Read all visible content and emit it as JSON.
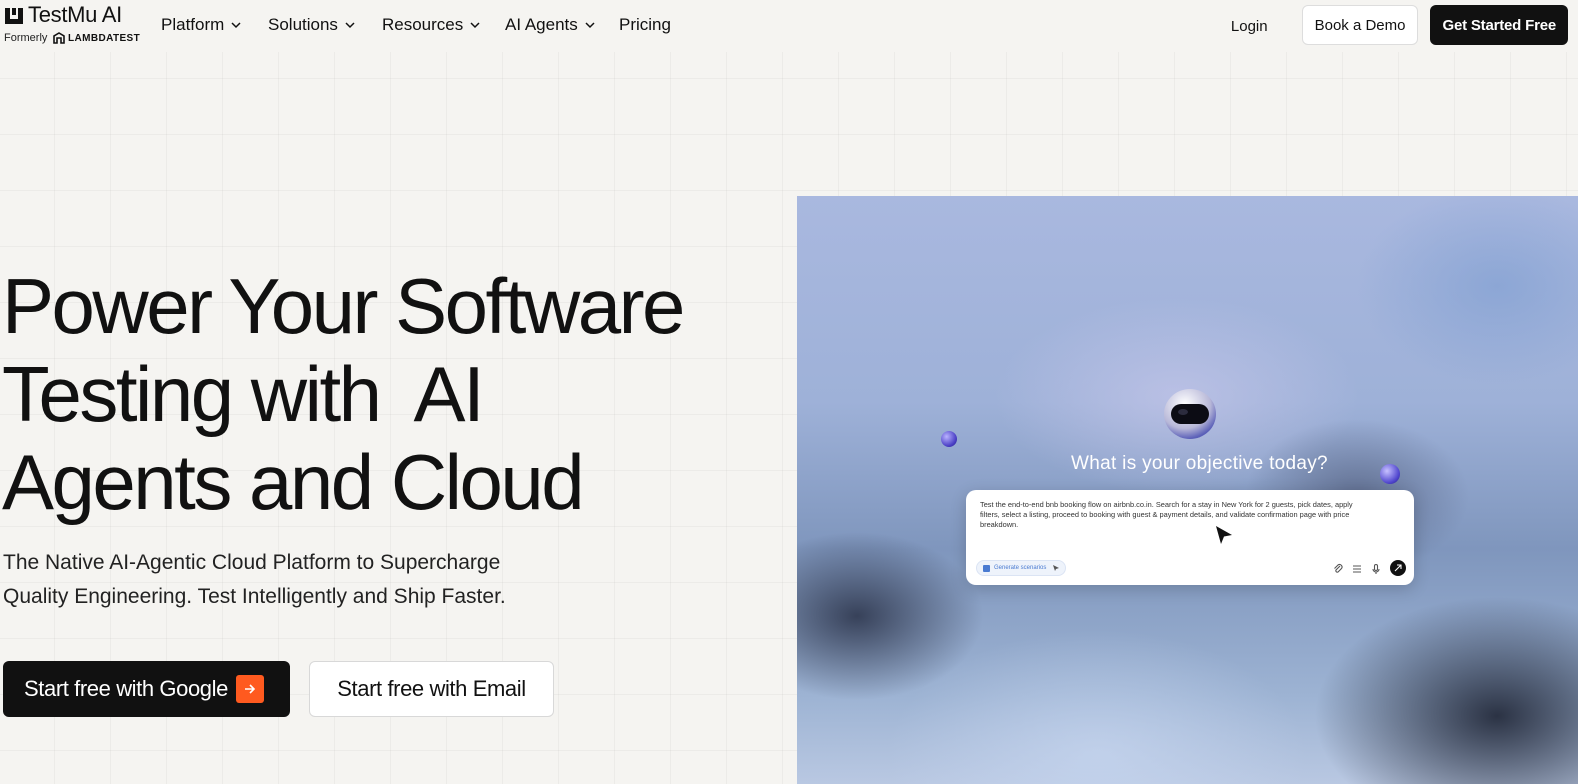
{
  "header": {
    "logo_text": "TestMu AI",
    "formerly": "Formerly",
    "lambdatest": "LAMBDATEST",
    "nav": {
      "platform": "Platform",
      "solutions": "Solutions",
      "resources": "Resources",
      "ai_agents": "AI Agents",
      "pricing": "Pricing"
    },
    "login": "Login",
    "book_demo": "Book a Demo",
    "get_started": "Get Started Free"
  },
  "hero": {
    "title_line1": "Power Your Software",
    "title_line2": "Testing with  AI",
    "title_line3": "Agents and Cloud",
    "subtitle_line1": "The Native AI-Agentic Cloud Platform to Supercharge",
    "subtitle_line2": "Quality Engineering. Test Intelligently and Ship Faster.",
    "btn_google": "Start free with Google",
    "btn_email": "Start free with Email"
  },
  "visual": {
    "objective": "What is your objective today?",
    "prompt": "Test the end-to-end bnb booking flow on airbnb.co.in. Search for a stay in New York for 2 guests, pick dates, apply filters, select a listing, proceed to booking with guest & payment details, and validate confirmation page with price breakdown.",
    "chip": "Generate scenarios"
  },
  "colors": {
    "accent": "#ff5a1f",
    "dark": "#111111",
    "background": "#f5f4f1"
  }
}
